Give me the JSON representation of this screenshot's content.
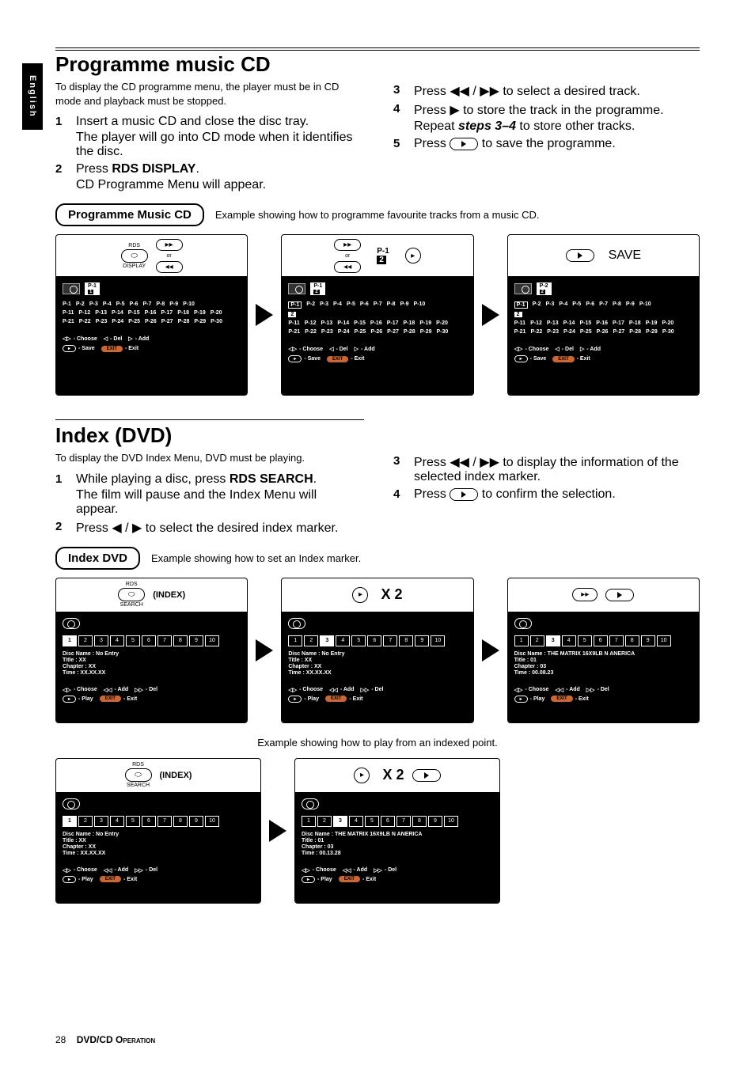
{
  "lang_tab": "English",
  "section1": {
    "title": "Programme music CD",
    "intro": "To display the CD programme menu, the player must be in CD mode and playback must be stopped.",
    "steps_left": [
      {
        "num": "1",
        "text": "Insert a music CD and close the disc tray.",
        "sub": "The player will go into CD mode when it identifies the disc."
      },
      {
        "num": "2",
        "text_pre": "Press ",
        "bold": "RDS DISPLAY",
        "text_post": ".",
        "sub": "CD Programme Menu will appear."
      }
    ],
    "steps_right": [
      {
        "num": "3",
        "text_pre": "Press ",
        "sym": "◀◀ / ▶▶",
        "text_post": " to select a desired track."
      },
      {
        "num": "4",
        "text_pre": "Press ",
        "sym": "▶",
        "text_post": " to store the track in the programme.",
        "sub_pre": "Repeat ",
        "sub_bold": "steps 3–4",
        "sub_post": " to store other tracks."
      },
      {
        "num": "5",
        "text_pre": "Press ",
        "sym": "▸",
        "text_post": " to save the programme."
      }
    ],
    "callout": "Programme Music CD",
    "callout_caption": "Example showing how to programme favourite tracks from a music CD.",
    "rds": {
      "top": "RDS",
      "bottom": "DISPLAY"
    },
    "or": "or",
    "save": "SAVE",
    "panels": [
      {
        "slot_top": "P-1",
        "slot_bottom": "1",
        "highlight": null
      },
      {
        "slot_top": "P-1",
        "slot_bottom": "2",
        "highlight": "P-1",
        "sel": "P-1\n2",
        "selbox": "2"
      },
      {
        "slot_top": "P-2",
        "slot_bottom": "2",
        "highlight": "P-1",
        "selbox": "2"
      }
    ],
    "plist1": [
      "P-1",
      "P-2",
      "P-3",
      "P-4",
      "P-5",
      "P-6",
      "P-7",
      "P-8",
      "P-9",
      "P-10"
    ],
    "plist2": [
      "P-11",
      "P-12",
      "P-13",
      "P-14",
      "P-15",
      "P-16",
      "P-17",
      "P-18",
      "P-19",
      "P-20"
    ],
    "plist3": [
      "P-21",
      "P-22",
      "P-23",
      "P-24",
      "P-25",
      "P-26",
      "P-27",
      "P-28",
      "P-29",
      "P-30"
    ],
    "controls": {
      "choose": "- Choose",
      "del": "- Del",
      "add": "- Add",
      "save": "- Save",
      "exit": "- Exit",
      "exit_pill": "EXIT"
    }
  },
  "section2": {
    "title": "Index (DVD)",
    "intro": "To display the DVD Index Menu, DVD must be playing.",
    "steps_left": [
      {
        "num": "1",
        "text_pre": "While playing a disc, press ",
        "bold": "RDS SEARCH",
        "text_post": ".",
        "sub": "The film will pause and the Index Menu will appear."
      },
      {
        "num": "2",
        "text_pre": "Press ",
        "sym": "◀ / ▶",
        "text_post": " to select the desired index marker."
      }
    ],
    "steps_right": [
      {
        "num": "3",
        "text_pre": "Press ",
        "sym": "◀◀ / ▶▶",
        "text_post": " to display the information of the selected index marker."
      },
      {
        "num": "4",
        "text_pre": "Press ",
        "sym": "▸",
        "text_post": " to confirm the selection."
      }
    ],
    "callout": "Index DVD",
    "callout_caption": "Example showing how to set an Index marker.",
    "caption2": "Example showing how to play from an indexed point.",
    "rds": {
      "top": "RDS",
      "bottom": "SEARCH"
    },
    "index_label": "(INDEX)",
    "x2": "X 2",
    "boxes": [
      "1",
      "2",
      "3",
      "4",
      "5",
      "6",
      "7",
      "8",
      "9",
      "10"
    ],
    "meta1": {
      "disc": "Disc Name : No Entry",
      "title": "Title : XX",
      "chapter": "Chapter : XX",
      "time": "Time : XX.XX.XX"
    },
    "meta2": {
      "disc": "Disc Name : No Entry",
      "title": "Title : XX",
      "chapter": "Chapter : XX",
      "time": "Time : XX.XX.XX"
    },
    "meta3": {
      "disc": "Disc Name : THE MATRIX 16X9LB N ANERICA",
      "title": "Title : 01",
      "chapter": "Chapter : 03",
      "time": "Time : 00.08.23"
    },
    "meta4": {
      "disc": "Disc Name : No Entry",
      "title": "Title : XX",
      "chapter": "Chapter : XX",
      "time": "Time : XX.XX.XX"
    },
    "meta5": {
      "disc": "Disc Name : THE MATRIX 16X9LB N ANERICA",
      "title": "Title : 01",
      "chapter": "Chapter : 03",
      "time": "Time : 00.13.28"
    },
    "controls": {
      "choose": "- Choose",
      "add": "- Add",
      "del": "- Del",
      "play": "- Play",
      "exit": "- Exit",
      "exit_pill": "EXIT"
    }
  },
  "footer": {
    "page": "28",
    "section": "DVD/CD Operation"
  }
}
